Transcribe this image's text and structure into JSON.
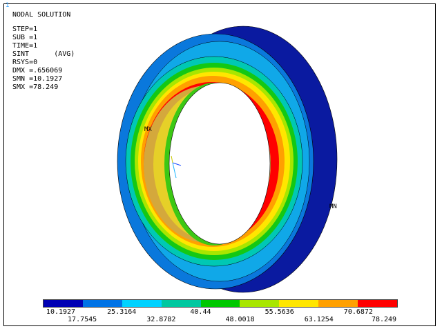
{
  "window": {
    "number": "1"
  },
  "info": {
    "title": "NODAL SOLUTION",
    "lines": [
      "STEP=1",
      "SUB =1",
      "TIME=1",
      "SINT      (AVG)",
      "RSYS=0",
      "DMX =.656069",
      "SMN =10.1927",
      "SMX =78.249"
    ]
  },
  "markers": {
    "max": "MX",
    "min": "MN"
  },
  "legend": {
    "colors": [
      "#0000b4",
      "#0073e6",
      "#00d2ff",
      "#00c8a0",
      "#00c800",
      "#a8e600",
      "#ffe600",
      "#ffa000",
      "#ff0000"
    ],
    "values": [
      "10.1927",
      "17.7545",
      "25.3164",
      "32.8782",
      "40.44",
      "48.0018",
      "55.5636",
      "63.1254",
      "70.6872",
      "78.249"
    ]
  }
}
